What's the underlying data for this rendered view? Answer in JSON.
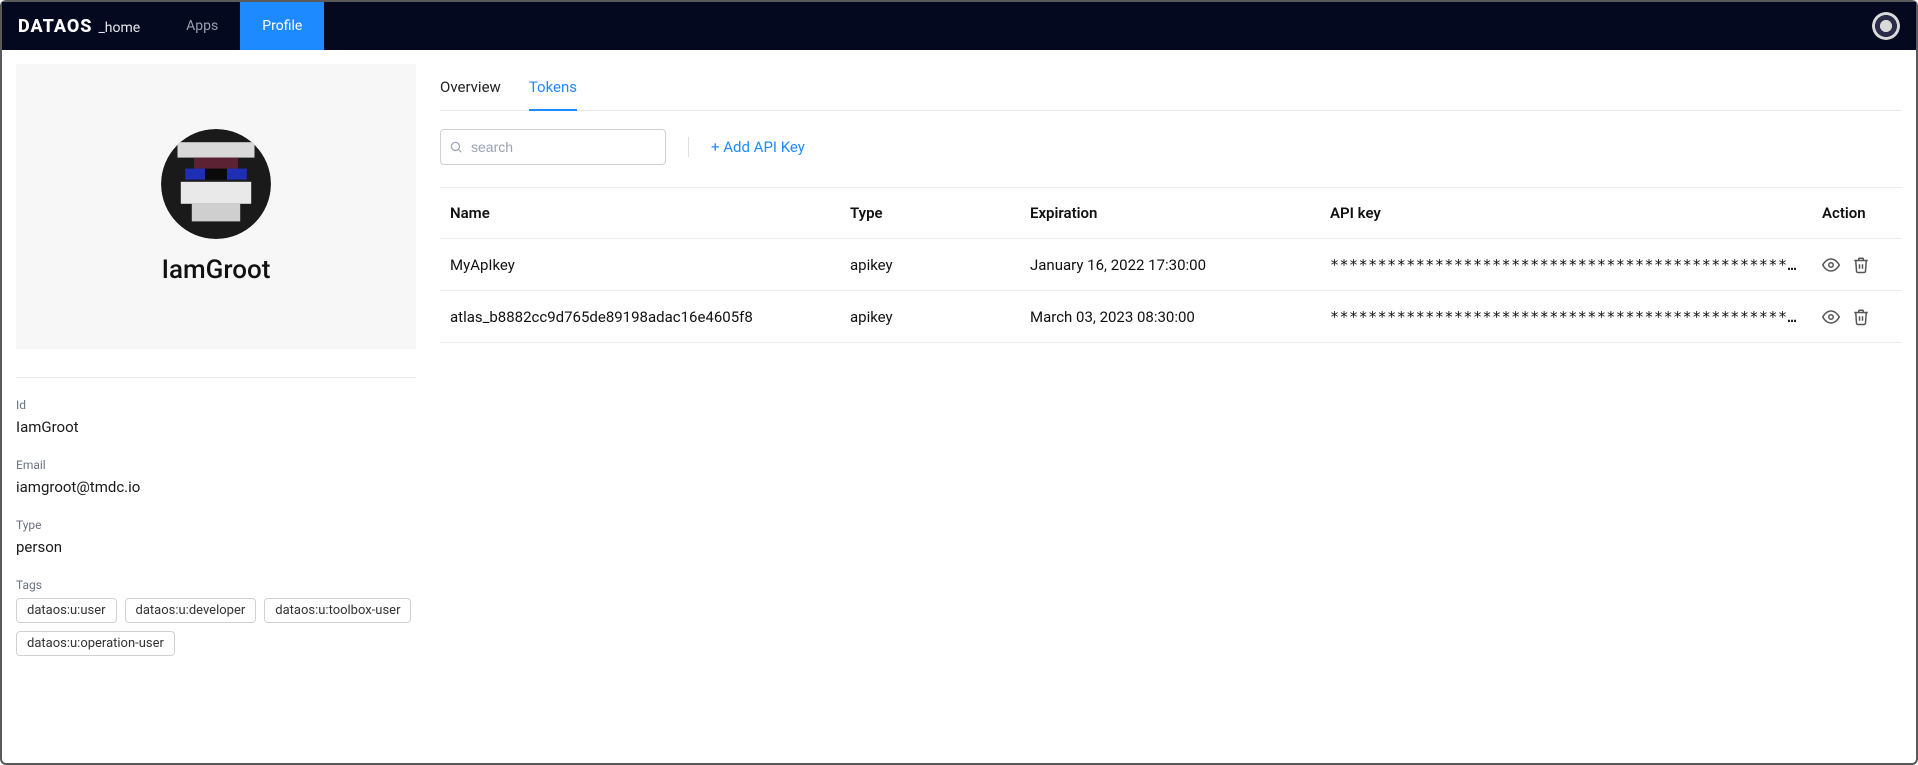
{
  "brand": {
    "main": "DATAOS",
    "sub": "_home"
  },
  "nav": {
    "apps": "Apps",
    "profile": "Profile"
  },
  "profile": {
    "display_name": "IamGroot",
    "id_label": "Id",
    "id_value": "IamGroot",
    "email_label": "Email",
    "email_value": "iamgroot@tmdc.io",
    "type_label": "Type",
    "type_value": "person",
    "tags_label": "Tags",
    "tags": [
      "dataos:u:user",
      "dataos:u:developer",
      "dataos:u:toolbox-user",
      "dataos:u:operation-user"
    ]
  },
  "subtabs": {
    "overview": "Overview",
    "tokens": "Tokens"
  },
  "toolbar": {
    "search_placeholder": "search",
    "add_api_key": "+ Add API Key"
  },
  "table": {
    "headers": {
      "name": "Name",
      "type": "Type",
      "expiration": "Expiration",
      "apikey": "API key",
      "action": "Action"
    },
    "rows": [
      {
        "name": "MyApIkey",
        "type": "apikey",
        "expiration": "January 16, 2022 17:30:00",
        "apikey": "************************************************…"
      },
      {
        "name": "atlas_b8882cc9d765de89198adac16e4605f8",
        "type": "apikey",
        "expiration": "March 03, 2023 08:30:00",
        "apikey": "************************************************…"
      }
    ]
  }
}
